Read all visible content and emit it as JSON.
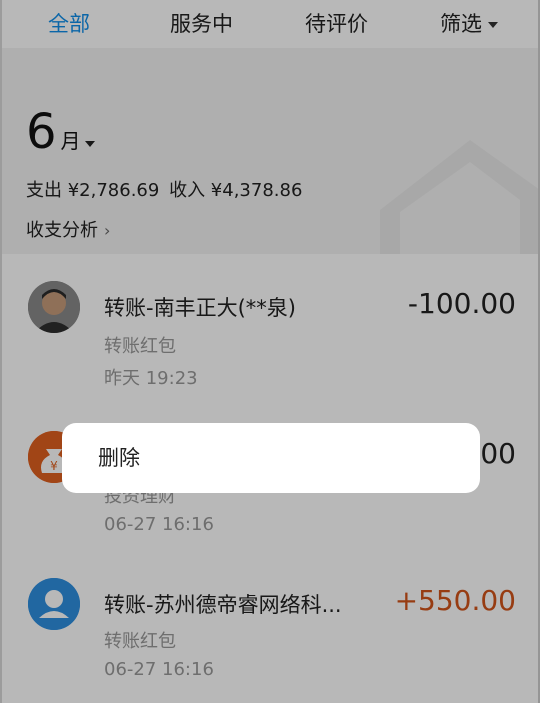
{
  "tabs": {
    "all": "全部",
    "in_service": "服务中",
    "to_review": "待评价",
    "filter": "筛选"
  },
  "summary": {
    "month_number": "6",
    "month_unit": "月",
    "expense": "支出 ¥2,786.69",
    "income": "收入 ¥4,378.86",
    "analysis": "收支分析"
  },
  "transactions": [
    {
      "title": "转账-南丰正大(**泉)",
      "subtitle": "转账红包",
      "time": "昨天  19:23",
      "amount": "-100.00"
    },
    {
      "title": "",
      "subtitle": "投资理财",
      "time": "06-27  16:16",
      "amount": "00"
    },
    {
      "title": "转账-苏州德帝睿网络科...",
      "subtitle": "转账红包",
      "time": "06-27  16:16",
      "amount": "+550.00"
    }
  ],
  "context_menu": {
    "delete": "删除"
  },
  "colors": {
    "accent": "#108ee9",
    "income": "#d2541a",
    "overlay": "rgba(0,0,0,0.28)"
  }
}
